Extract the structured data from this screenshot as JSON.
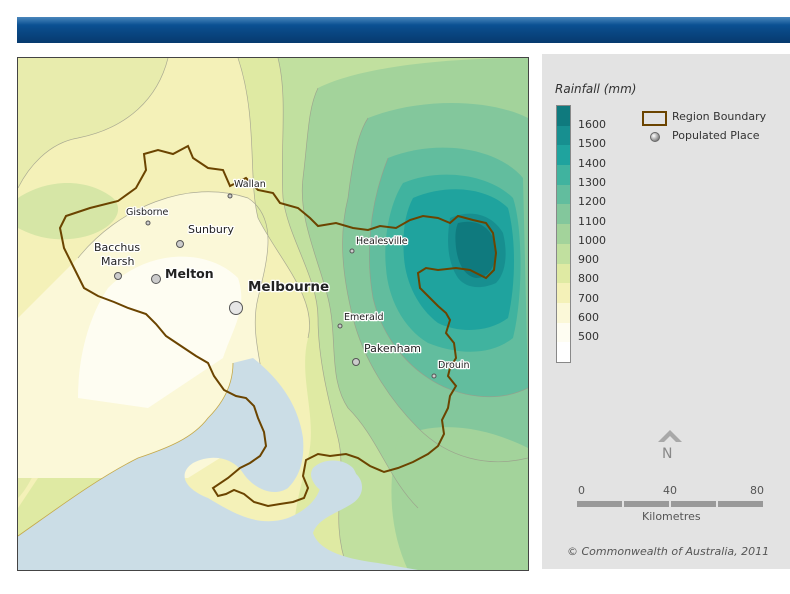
{
  "legend": {
    "title": "Rainfall (mm)",
    "scale": [
      {
        "label": "1600",
        "color": "#0f7a7e"
      },
      {
        "label": "1500",
        "color": "#178f90"
      },
      {
        "label": "1400",
        "color": "#1fa39e"
      },
      {
        "label": "1300",
        "color": "#40b39f"
      },
      {
        "label": "1200",
        "color": "#62bd9e"
      },
      {
        "label": "1100",
        "color": "#83c79c"
      },
      {
        "label": "1000",
        "color": "#a3d39b"
      },
      {
        "label": "900",
        "color": "#c1e09f"
      },
      {
        "label": "800",
        "color": "#dfeaa3"
      },
      {
        "label": "700",
        "color": "#f4f1b8"
      },
      {
        "label": "600",
        "color": "#fbf8d8"
      },
      {
        "label": "500",
        "color": "#fefdf2"
      },
      {
        "label": "",
        "color": "#ffffff"
      }
    ],
    "boundary_label": "Region Boundary",
    "place_label": "Populated Place"
  },
  "north": "N",
  "scalebar": {
    "ticks": [
      "0",
      "40",
      "80"
    ],
    "unit": "Kilometres"
  },
  "copyright": "© Commonwealth of Australia, 2011",
  "places": {
    "wallan": "Wallan",
    "gisborne": "Gisborne",
    "sunbury": "Sunbury",
    "bacchus1": "Bacchus",
    "bacchus2": "Marsh",
    "melton": "Melton",
    "melbourne": "Melbourne",
    "healesville": "Healesville",
    "emerald": "Emerald",
    "pakenham": "Pakenham",
    "drouin": "Drouin"
  },
  "colors": {
    "water": "#cbdde6",
    "boundary": "#6b4400",
    "banner": "#0a4b8a"
  }
}
